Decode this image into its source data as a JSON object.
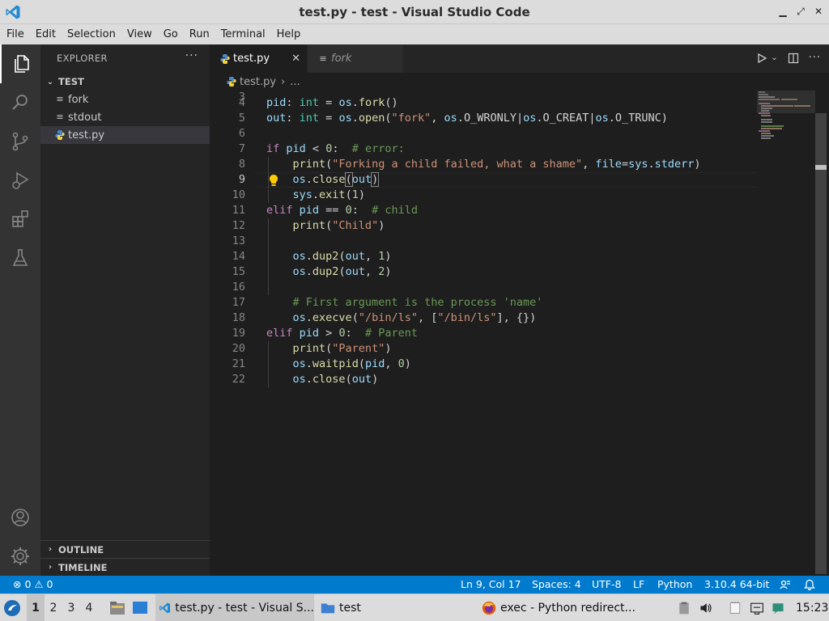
{
  "window": {
    "title": "test.py - test - Visual Studio Code",
    "min_glyph": "▁",
    "max_glyph": "✕",
    "close_glyph": "✕",
    "restore_glyph": "⤢"
  },
  "menu": [
    "File",
    "Edit",
    "Selection",
    "View",
    "Go",
    "Run",
    "Terminal",
    "Help"
  ],
  "sidebar": {
    "header": "EXPLORER",
    "more": "···",
    "folder": "TEST",
    "files": [
      "fork",
      "stdout",
      "test.py"
    ],
    "outline": "OUTLINE",
    "timeline": "TIMELINE"
  },
  "tabs": [
    {
      "label": "test.py",
      "close": "✕"
    },
    {
      "label": "fork"
    }
  ],
  "breadcrumb": {
    "file": "test.py",
    "sep": "›",
    "rest": "..."
  },
  "editor": {
    "current_line": 9,
    "line_numbers": [
      "3",
      "4",
      "5",
      "6",
      "7",
      "8",
      "9",
      "10",
      "11",
      "12",
      "13",
      "14",
      "15",
      "16",
      "17",
      "18",
      "19",
      "20",
      "21",
      "22"
    ]
  },
  "statusbar": {
    "problems": "⊗ 0 ⚠ 0",
    "position": "Ln 9, Col 17",
    "spaces": "Spaces: 4",
    "encoding": "UTF-8",
    "eol": "LF",
    "language": "Python",
    "interpreter": "3.10.4 64-bit"
  },
  "taskbar": {
    "workspaces": [
      "1",
      "2",
      "3",
      "4"
    ],
    "active_workspace": "1",
    "vscode_task": "test.py - test - Visual S...",
    "folder_task": "test",
    "browser_task": "exec - Python redirect...",
    "clock": "15:23"
  },
  "colors": {
    "accent": "#007acc",
    "keyword": "#c586c0",
    "function": "#dcdcaa",
    "string": "#ce9178",
    "comment": "#6a9955",
    "number": "#b5cea8",
    "type": "#4ec9b0",
    "variable": "#9cdcfe"
  }
}
